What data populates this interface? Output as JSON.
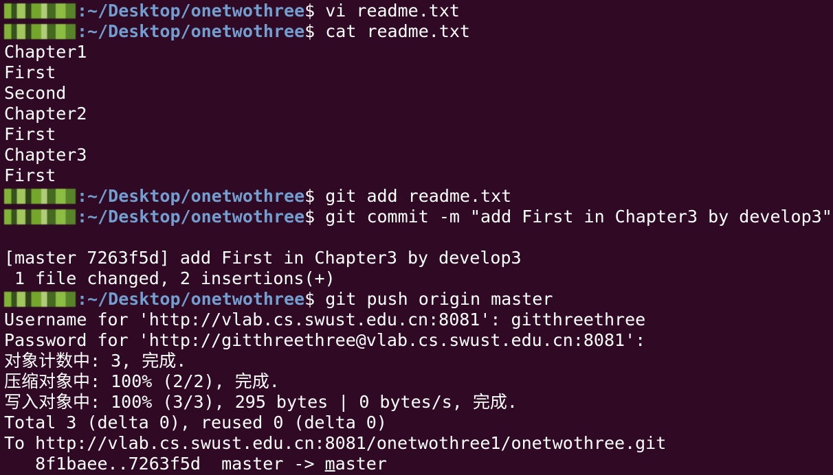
{
  "terminal": {
    "path": "~/Desktop/onetwothree",
    "lines": [
      {
        "type": "prompt",
        "cmd": "vi readme.txt"
      },
      {
        "type": "prompt",
        "cmd": "cat readme.txt"
      },
      {
        "type": "out",
        "text": "Chapter1"
      },
      {
        "type": "out",
        "text": "First"
      },
      {
        "type": "out",
        "text": "Second"
      },
      {
        "type": "out",
        "text": "Chapter2"
      },
      {
        "type": "out",
        "text": "First"
      },
      {
        "type": "out",
        "text": "Chapter3"
      },
      {
        "type": "out",
        "text": "First"
      },
      {
        "type": "prompt",
        "cmd": "git add readme.txt"
      },
      {
        "type": "prompt",
        "cmd": "git commit -m \"add First in Chapter3 by develop3\""
      },
      {
        "type": "out",
        "text": ""
      },
      {
        "type": "out",
        "text": "[master 7263f5d] add First in Chapter3 by develop3"
      },
      {
        "type": "out",
        "text": " 1 file changed, 2 insertions(+)"
      },
      {
        "type": "prompt",
        "cmd": "git push origin master"
      },
      {
        "type": "out",
        "text": "Username for 'http://vlab.cs.swust.edu.cn:8081': gitthreethree"
      },
      {
        "type": "out",
        "text": "Password for 'http://gitthreethree@vlab.cs.swust.edu.cn:8081':"
      },
      {
        "type": "out",
        "text": "对象计数中: 3, 完成."
      },
      {
        "type": "out",
        "text": "压缩对象中: 100% (2/2), 完成."
      },
      {
        "type": "out",
        "text": "写入对象中: 100% (3/3), 295 bytes | 0 bytes/s, 完成."
      },
      {
        "type": "out",
        "text": "Total 3 (delta 0), reused 0 (delta 0)"
      },
      {
        "type": "out",
        "text": "To http://vlab.cs.swust.edu.cn:8081/onetwothree1/onetwothree.git"
      },
      {
        "type": "cursor",
        "before": "   8f1baee..7263f5d  master -> ",
        "cursor_char": "m",
        "after": "aster"
      }
    ]
  },
  "colors": {
    "background": "#300a24",
    "path": "#729fcf",
    "text": "#ffffff"
  }
}
